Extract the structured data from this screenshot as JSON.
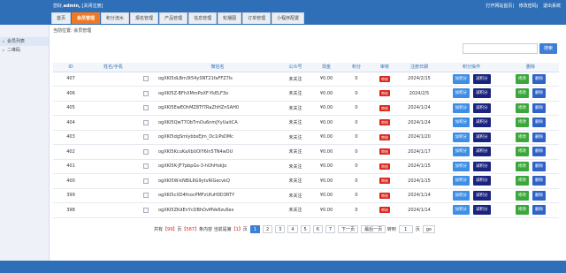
{
  "header": {
    "greeting_prefix": "您好,",
    "user": "admin,",
    "logout_label": "[关闭注册]",
    "links": [
      "打开网站首页",
      "修改密码",
      "退出系统"
    ]
  },
  "nav": {
    "tabs": [
      "首页",
      "会员管理",
      "积分流水",
      "报名管理",
      "产品管理",
      "信息管理",
      "轮播图",
      "订单管理",
      "小程序配置"
    ],
    "active_index": 1
  },
  "sidebar": {
    "items": [
      "会员列表",
      "二维码"
    ]
  },
  "breadcrumb": "当前位置: 会员管理",
  "search": {
    "placeholder": "",
    "button": "搜索"
  },
  "table": {
    "headers": [
      "ID",
      "姓名/手机",
      "",
      "微信名",
      "公众号",
      "现金",
      "积分",
      "审核",
      "注册日期",
      "积分操作",
      "删除"
    ],
    "rows": [
      {
        "id": "407",
        "openid": "ogXKI5dLBm3t54ySNT21faFFZ7Is",
        "follow": "未关注",
        "cash": "¥0.00",
        "points": "0",
        "audit": "审核",
        "date": "2024/2/15"
      },
      {
        "id": "406",
        "openid": "ogXKI5Z-BFhXMmPoXF-YkELF3o",
        "follow": "未关注",
        "cash": "¥0.00",
        "points": "0",
        "audit": "审核",
        "date": "2024/2/5"
      },
      {
        "id": "405",
        "openid": "ogXKI5EwEOhMZ8Tf7RaZhHZnSAH0",
        "follow": "未关注",
        "cash": "¥0.00",
        "points": "0",
        "audit": "审核",
        "date": "2024/1/24"
      },
      {
        "id": "404",
        "openid": "ogXKI5QwT7ObTmOu6nmJYyUaitCA",
        "follow": "未关注",
        "cash": "¥0.00",
        "points": "0",
        "audit": "审核",
        "date": "2024/1/24"
      },
      {
        "id": "403",
        "openid": "ogXKI5dgSmlybbsEJm_Dc1iPsDMc",
        "follow": "未关注",
        "cash": "¥0.00",
        "points": "0",
        "audit": "审核",
        "date": "2024/1/20"
      },
      {
        "id": "402",
        "openid": "ogXKI5KcuKaXbUOlY6In5TN4wDU",
        "follow": "未关注",
        "cash": "¥0.00",
        "points": "0",
        "audit": "审核",
        "date": "2024/1/17"
      },
      {
        "id": "401",
        "openid": "ogXKI5K-JF7pbpGs-3-hOhHokJo",
        "follow": "未关注",
        "cash": "¥0.00",
        "points": "0",
        "audit": "审核",
        "date": "2024/1/15"
      },
      {
        "id": "400",
        "openid": "ogXKI5W-kNBIL6G9ytvRiGecvkQ",
        "follow": "未关注",
        "cash": "¥0.00",
        "points": "0",
        "audit": "审核",
        "date": "2024/1/15"
      },
      {
        "id": "399",
        "openid": "ogXKI5cXD4fnocPMFzUfuH0D3RTY",
        "follow": "未关注",
        "cash": "¥0.00",
        "points": "0",
        "audit": "审核",
        "date": "2024/1/14"
      },
      {
        "id": "398",
        "openid": "ogXKI5ZKdEnYcDBhOvMVe6zu6es",
        "follow": "未关注",
        "cash": "¥0.00",
        "points": "0",
        "audit": "审核",
        "date": "2024/1/14"
      }
    ],
    "btn_add": "加积分",
    "btn_sub": "减积分",
    "btn_edit": "修改",
    "btn_del": "删除"
  },
  "pager": {
    "total_label_a": "共有",
    "total_pages": "【99】",
    "total_label_b": "页",
    "total_records": "【587】",
    "total_label_c": "条内容",
    "current_label_a": "当前是第",
    "current_page": "【1】",
    "current_label_b": "页",
    "pages": [
      "1",
      "2",
      "3",
      "4",
      "5",
      "6",
      "7"
    ],
    "next": "下一页",
    "last": "最后一页",
    "jump_to": "转到",
    "jump_value": "1",
    "jump_unit": "页",
    "go": "go"
  },
  "colors": {
    "primary": "#2f6fb7",
    "active_tab": "#f07a23",
    "danger": "#d9261c",
    "success": "#3aa73a"
  }
}
